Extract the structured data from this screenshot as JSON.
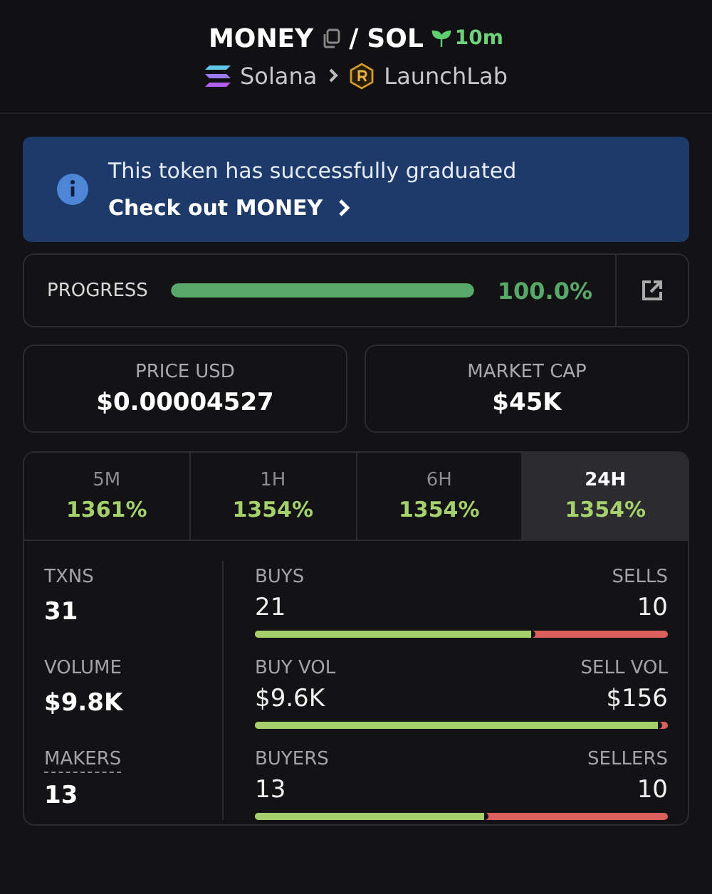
{
  "header": {
    "token": "MONEY",
    "separator": "/",
    "quote": "SOL",
    "age": "10m",
    "chain": "Solana",
    "platform": "LaunchLab"
  },
  "banner": {
    "message": "This token has successfully graduated",
    "link": "Check out MONEY"
  },
  "progress": {
    "label": "PROGRESS",
    "level": 1.0,
    "reading": "100.0%"
  },
  "cards": [
    {
      "label": "PRICE USD",
      "value": "$0.00004527"
    },
    {
      "label": "MARKET CAP",
      "value": "$45K"
    }
  ],
  "tabs": [
    {
      "label": "5M",
      "change": "1361%",
      "selected": false
    },
    {
      "label": "1H",
      "change": "1354%",
      "selected": false
    },
    {
      "label": "6H",
      "change": "1354%",
      "selected": false
    },
    {
      "label": "24H",
      "change": "1354%",
      "selected": true
    }
  ],
  "stats": [
    {
      "label": "TXNS",
      "value": "31",
      "left_label": "BUYS",
      "left_value": "21",
      "right_label": "SELLS",
      "right_value": "10",
      "level": 0.68
    },
    {
      "label": "VOLUME",
      "value": "$9.8K",
      "left_label": "BUY VOL",
      "left_value": "$9.6K",
      "right_label": "SELL VOL",
      "right_value": "$156",
      "level": 0.985
    },
    {
      "label": "MAKERS",
      "value": "13",
      "left_label": "BUYERS",
      "left_value": "13",
      "right_label": "SELLERS",
      "right_value": "10",
      "level": 0.565
    }
  ]
}
